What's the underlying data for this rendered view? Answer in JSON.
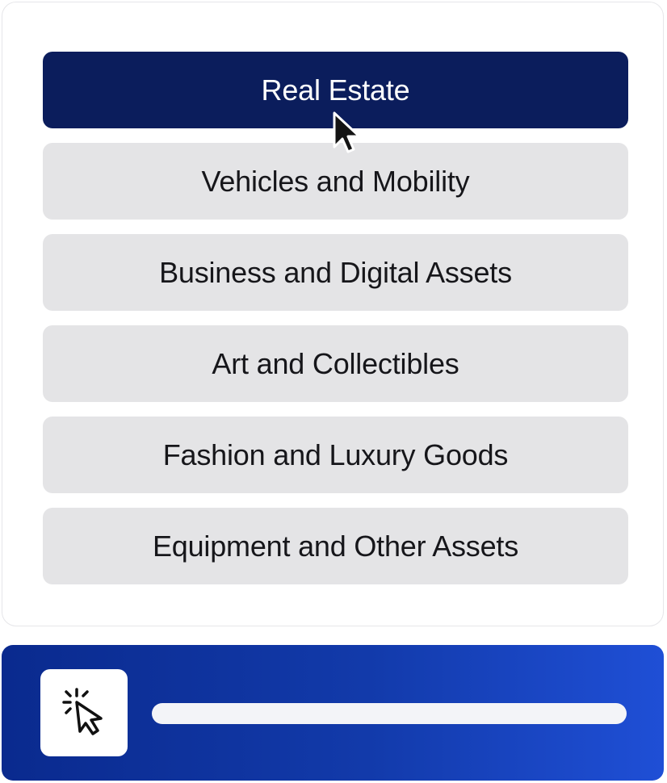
{
  "options": [
    {
      "label": "Real Estate",
      "selected": true
    },
    {
      "label": "Vehicles and Mobility",
      "selected": false
    },
    {
      "label": "Business and Digital Assets",
      "selected": false
    },
    {
      "label": "Art and Collectibles",
      "selected": false
    },
    {
      "label": "Fashion and Luxury Goods",
      "selected": false
    },
    {
      "label": "Equipment and Other Assets",
      "selected": false
    }
  ],
  "icons": {
    "pointer": "mouse-pointer-icon",
    "click": "click-icon"
  },
  "colors": {
    "selected_bg": "#0b1d5c",
    "option_bg": "#e4e4e6",
    "bar_gradient_start": "#0a2a8e",
    "bar_gradient_end": "#1f4fd6"
  },
  "progress": {
    "fraction": 1.0
  }
}
